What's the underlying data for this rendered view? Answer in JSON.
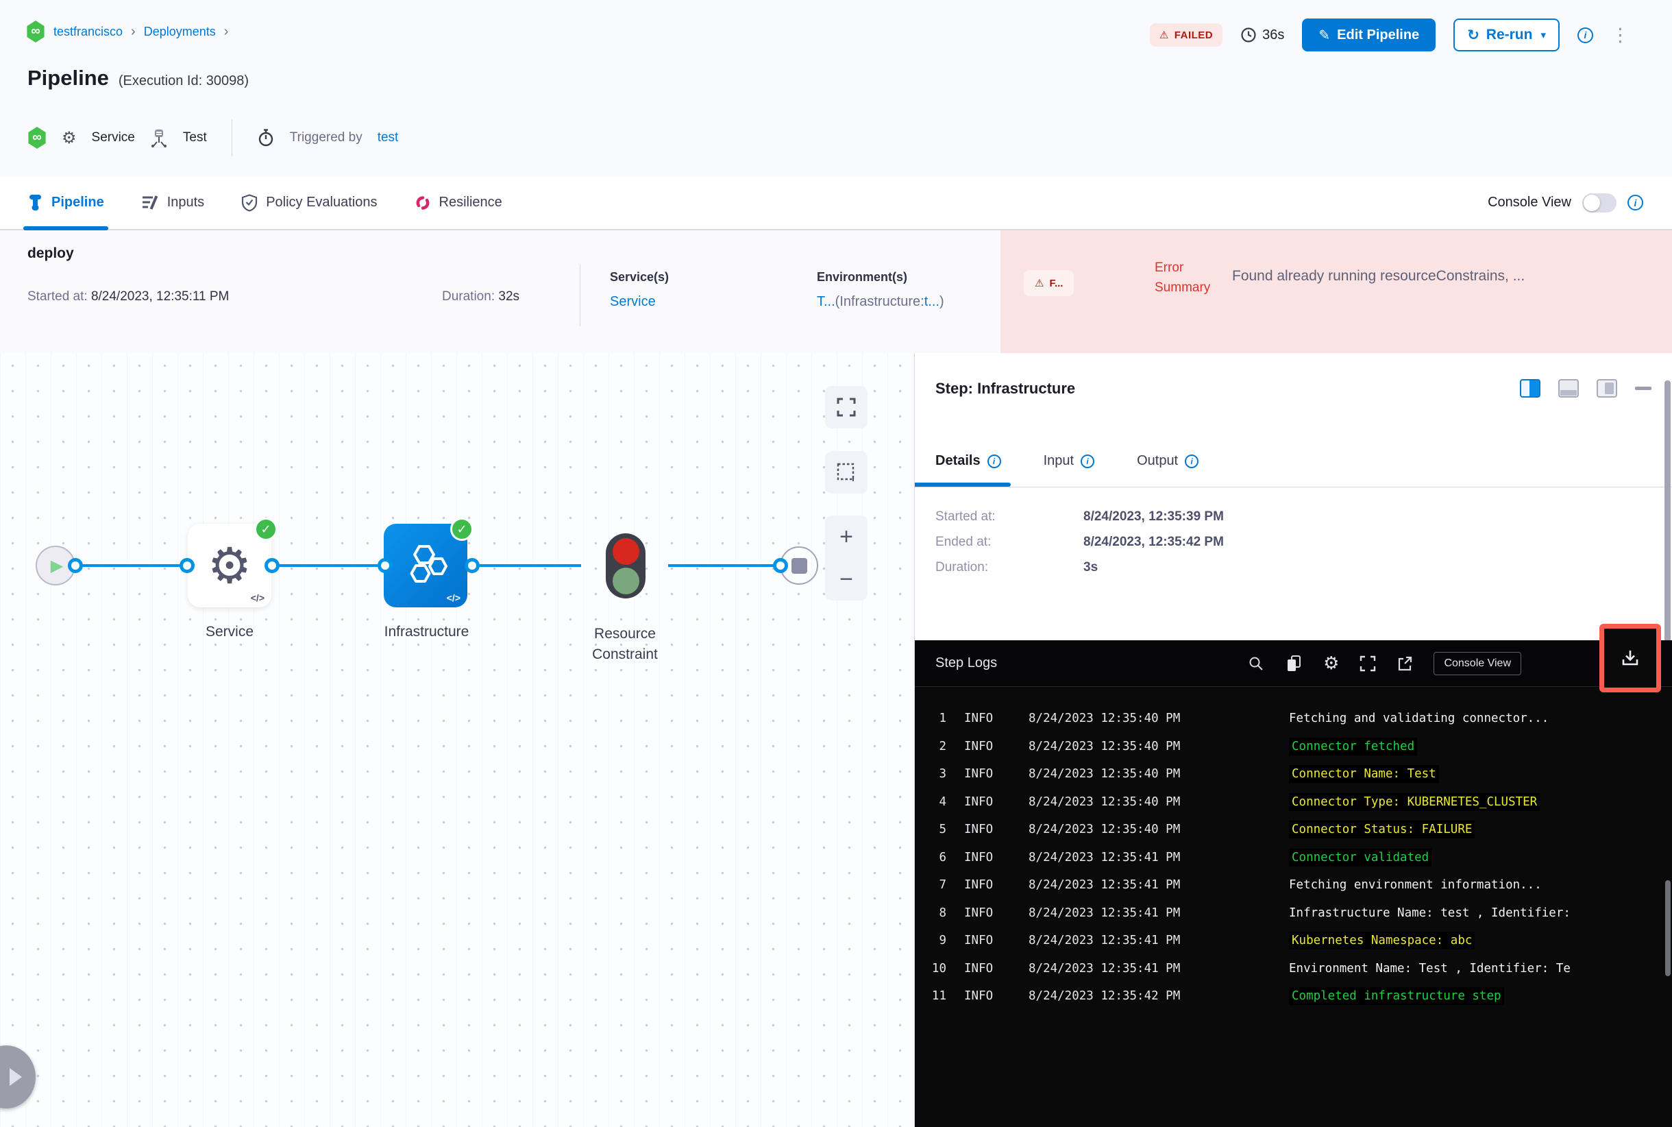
{
  "icons": {
    "infinity": "∞",
    "gear": "⚙",
    "warning": "⚠",
    "pencil": "✎",
    "refresh": "↻",
    "caret_down": "▾",
    "info": "i",
    "kebab": "⋮",
    "check": "✓",
    "play": "▶",
    "chevron": "›",
    "plus": "+",
    "minus": "−",
    "code": "</>"
  },
  "colors": {
    "accent_blue": "#0278d5",
    "edge_blue": "#0092e4",
    "failed_red": "#b41710",
    "error_bg": "#fbe3e3",
    "success_green": "#3fbb4c",
    "log_green": "#1fd042",
    "log_yellow": "#ece73b",
    "highlight_red": "#f95d4d"
  },
  "breadcrumb": {
    "project": "testfrancisco",
    "section": "Deployments"
  },
  "header": {
    "title": "Pipeline",
    "execution_id": "(Execution Id: 30098)",
    "status": "FAILED",
    "duration": "36s",
    "edit_button": "Edit Pipeline",
    "rerun_button": "Re-run",
    "service_label": "Service",
    "env_label": "Test",
    "triggered_by_label": "Triggered by",
    "triggered_by_value": "test"
  },
  "tabbar": {
    "tabs": [
      {
        "label": "Pipeline"
      },
      {
        "label": "Inputs"
      },
      {
        "label": "Policy Evaluations"
      },
      {
        "label": "Resilience"
      }
    ],
    "console_view": "Console View"
  },
  "stage": {
    "name": "deploy",
    "started_label": "Started at: ",
    "started_value": "8/24/2023, 12:35:11 PM",
    "duration_label": "Duration: ",
    "duration_value": "32s",
    "services_label": "Service(s)",
    "services_value": "Service",
    "environments_label": "Environment(s)",
    "env_link1": "T...",
    "env_paren_open": "(Infrastructure:",
    "env_link2": "t...",
    "env_paren_close": ")",
    "error_badge": "F...",
    "error_label": "Error Summary",
    "error_message": "Found already running resourceConstrains, ..."
  },
  "graph": {
    "nodes": [
      {
        "label": "Service"
      },
      {
        "label": "Infrastructure"
      },
      {
        "label": "Resource Constraint"
      }
    ]
  },
  "panel": {
    "title": "Step: Infrastructure",
    "tabs": [
      {
        "label": "Details"
      },
      {
        "label": "Input"
      },
      {
        "label": "Output"
      }
    ],
    "details": {
      "started_label": "Started at:",
      "started_value": "8/24/2023, 12:35:39 PM",
      "ended_label": "Ended at:",
      "ended_value": "8/24/2023, 12:35:42 PM",
      "duration_label": "Duration:",
      "duration_value": "3s"
    }
  },
  "logs": {
    "title": "Step Logs",
    "console_view_button": "Console View",
    "rows": [
      {
        "num": "1",
        "level": "INFO",
        "time": "8/24/2023 12:35:40 PM",
        "message": "Fetching and validating connector...",
        "color": "white"
      },
      {
        "num": "2",
        "level": "INFO",
        "time": "8/24/2023 12:35:40 PM",
        "message": "Connector fetched",
        "color": "green"
      },
      {
        "num": "3",
        "level": "INFO",
        "time": "8/24/2023 12:35:40 PM",
        "message": "Connector Name: Test",
        "color": "yellow"
      },
      {
        "num": "4",
        "level": "INFO",
        "time": "8/24/2023 12:35:40 PM",
        "message": "Connector Type: KUBERNETES_CLUSTER",
        "color": "yellow"
      },
      {
        "num": "5",
        "level": "INFO",
        "time": "8/24/2023 12:35:40 PM",
        "message": "Connector Status: FAILURE",
        "color": "yellow"
      },
      {
        "num": "6",
        "level": "INFO",
        "time": "8/24/2023 12:35:41 PM",
        "message": "Connector validated",
        "color": "green"
      },
      {
        "num": "7",
        "level": "INFO",
        "time": "8/24/2023 12:35:41 PM",
        "message": "Fetching environment information...",
        "color": "white"
      },
      {
        "num": "8",
        "level": "INFO",
        "time": "8/24/2023 12:35:41 PM",
        "message": "Infrastructure Name: test , Identifier:",
        "color": "white"
      },
      {
        "num": "9",
        "level": "INFO",
        "time": "8/24/2023 12:35:41 PM",
        "message": "Kubernetes Namespace: abc",
        "color": "yellow"
      },
      {
        "num": "10",
        "level": "INFO",
        "time": "8/24/2023 12:35:41 PM",
        "message": "Environment Name: Test , Identifier: Te",
        "color": "white"
      },
      {
        "num": "11",
        "level": "INFO",
        "time": "8/24/2023 12:35:42 PM",
        "message": "Completed infrastructure step",
        "color": "green"
      }
    ]
  }
}
